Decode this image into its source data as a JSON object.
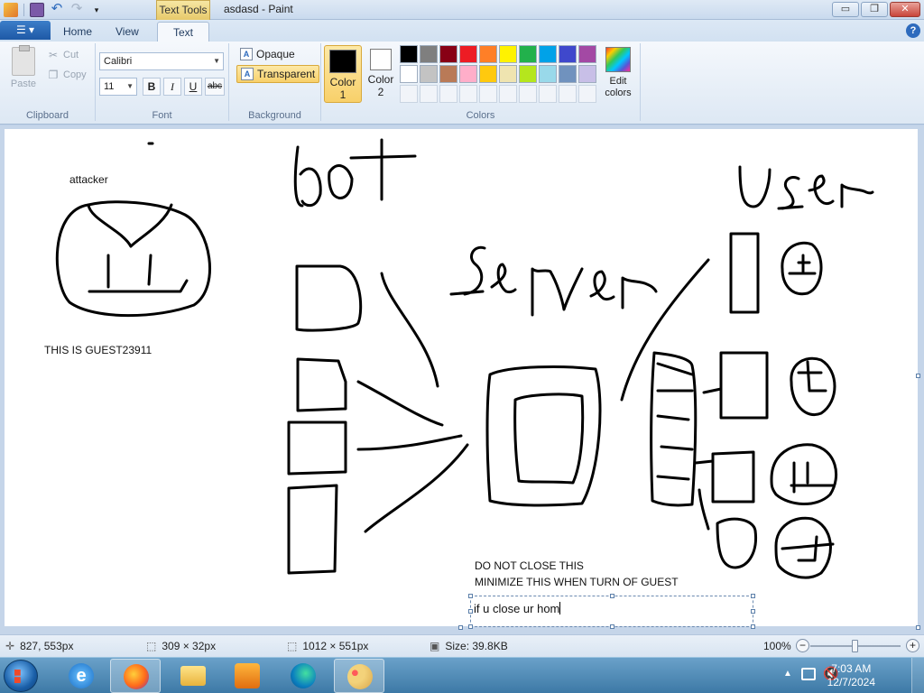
{
  "window": {
    "context_tab": "Text Tools",
    "title": "asdasd - Paint",
    "min_glyph": "▭",
    "max_glyph": "❐",
    "close_glyph": "✕",
    "help_glyph": "?"
  },
  "tabs": {
    "file_glyph": "☰ ▾",
    "items": [
      "Home",
      "View",
      "Text"
    ],
    "active": "Text"
  },
  "ribbon": {
    "clipboard": {
      "label": "Clipboard",
      "paste": "Paste",
      "cut": "Cut",
      "copy": "Copy"
    },
    "font": {
      "label": "Font",
      "family": "Calibri",
      "size": "11",
      "bold": "B",
      "italic": "I",
      "underline": "U",
      "strike": "abc"
    },
    "background": {
      "label": "Background",
      "opaque": "Opaque",
      "transparent": "Transparent",
      "selected": "Transparent"
    },
    "colors": {
      "label": "Colors",
      "color1_label": "Color\n1",
      "color1_line1": "Color",
      "color1_line2": "1",
      "color2_line1": "Color",
      "color2_line2": "2",
      "color1": "#000000",
      "color2": "#ffffff",
      "palette_row1": [
        "#000000",
        "#7f7f7f",
        "#880015",
        "#ed1c24",
        "#ff7f27",
        "#fff200",
        "#22b14c",
        "#00a2e8",
        "#3f48cc",
        "#a349a4"
      ],
      "palette_row2": [
        "#ffffff",
        "#c3c3c3",
        "#b97a57",
        "#ffaec9",
        "#ffc90e",
        "#efe4b0",
        "#b5e61d",
        "#99d9ea",
        "#7092be",
        "#c8bfe7"
      ],
      "edit_line1": "Edit",
      "edit_line2": "colors"
    }
  },
  "canvas": {
    "texts": {
      "attacker": "attacker",
      "guest": "THIS IS GUEST23911",
      "warn1": "DO NOT CLOSE THIS",
      "warn2": "MINIMIZE THIS WHEN TURN OF GUEST"
    },
    "textbox_value": "if u close ur hom"
  },
  "status": {
    "cursor_pos": "827, 553px",
    "selection_size": "309 × 32px",
    "image_size": "1012 × 551px",
    "file_size": "Size: 39.8KB",
    "zoom": "100%",
    "zoom_level": 0.5
  },
  "taskbar": {
    "apps": [
      "internet-explorer",
      "firefox",
      "file-explorer",
      "media-player",
      "edge",
      "paint"
    ],
    "active_app": "paint",
    "time": "7:03 AM",
    "date": "12/7/2024"
  }
}
